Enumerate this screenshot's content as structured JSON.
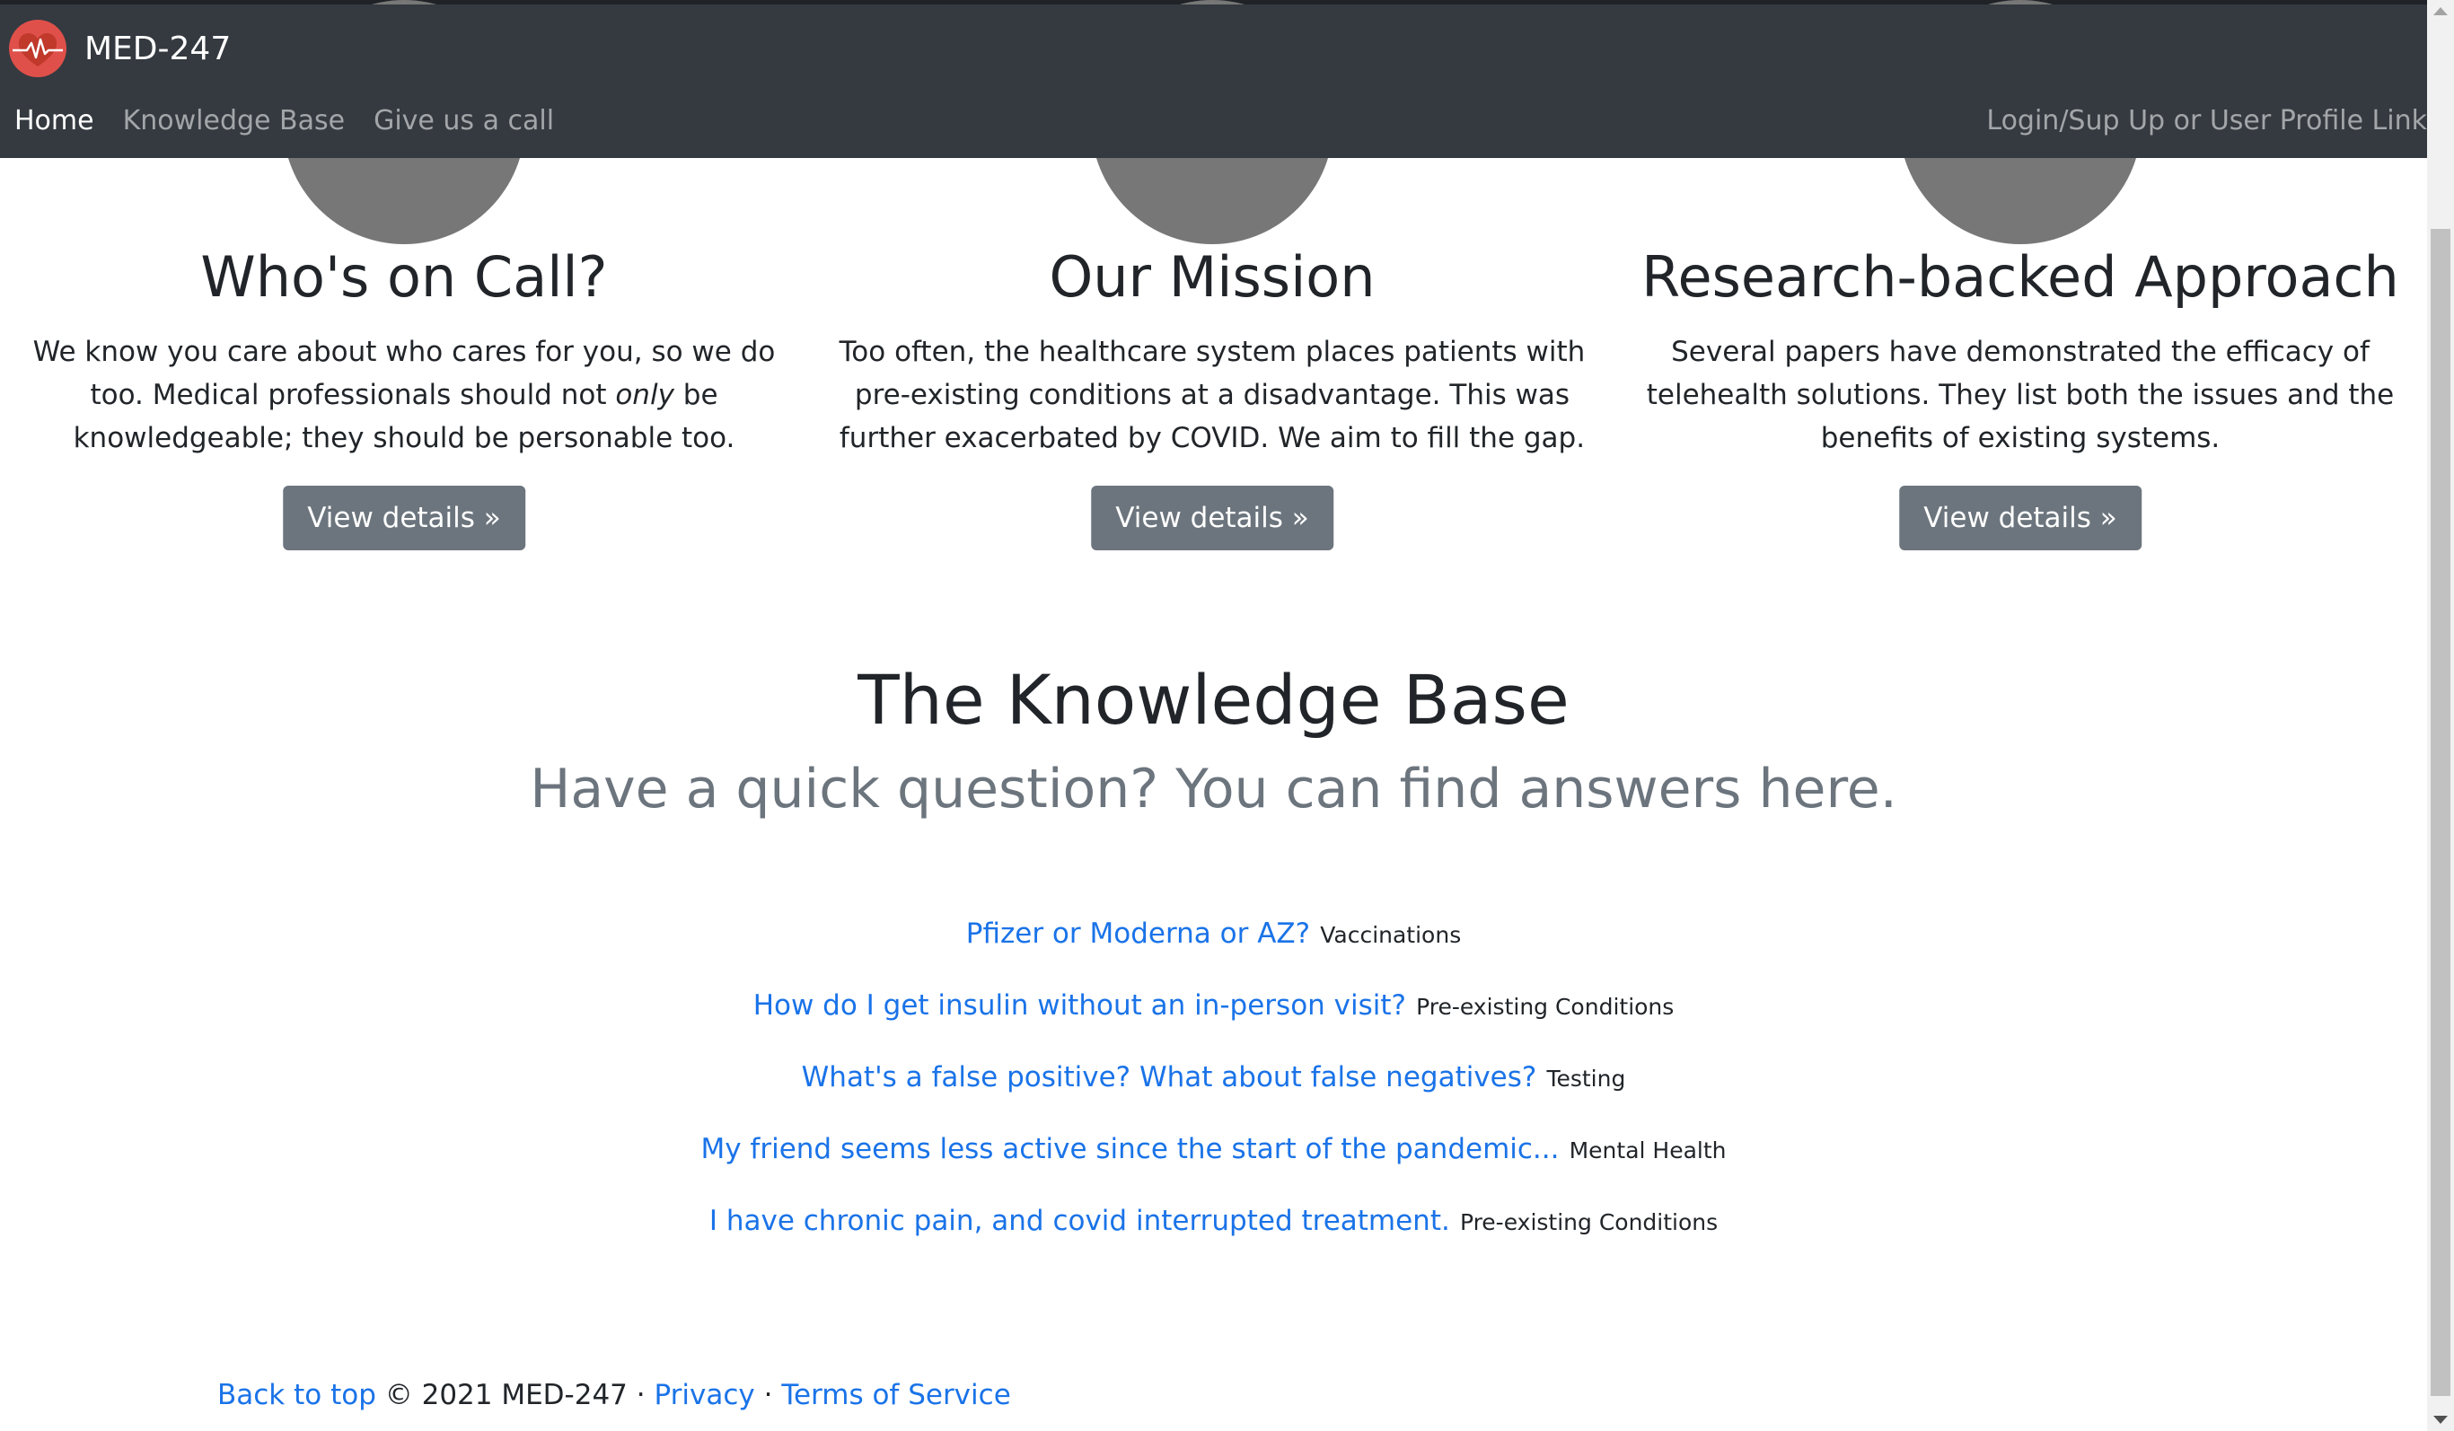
{
  "navbar": {
    "brand": "MED-247",
    "links": [
      {
        "label": "Home",
        "active": true
      },
      {
        "label": "Knowledge Base",
        "active": false
      },
      {
        "label": "Give us a call",
        "active": false
      }
    ],
    "right_link": "Login/Sup Up or User Profile Link"
  },
  "features": [
    {
      "title": "Who's on Call?",
      "text_before": "We know you care about who cares for you, so we do too. Medical professionals should not ",
      "text_em": "only",
      "text_after": " be knowledgeable; they should be personable too.",
      "button": "View details »"
    },
    {
      "title": "Our Mission",
      "text_before": "Too often, the healthcare system places patients with pre-existing conditions at a disadvantage. This was further exacerbated by COVID. We aim to fill the gap.",
      "text_em": "",
      "text_after": "",
      "button": "View details »"
    },
    {
      "title": "Research-backed Approach",
      "text_before": "Several papers have demonstrated the efficacy of telehealth solutions. They list both the issues and the benefits of existing systems.",
      "text_em": "",
      "text_after": "",
      "button": "View details »"
    }
  ],
  "knowledge_base": {
    "title": "The Knowledge Base",
    "subtitle": "Have a quick question? You can find answers here.",
    "items": [
      {
        "question": "Pfizer or Moderna or AZ?",
        "tag": "Vaccinations"
      },
      {
        "question": "How do I get insulin without an in-person visit?",
        "tag": "Pre-existing Conditions"
      },
      {
        "question": "What's a false positive? What about false negatives?",
        "tag": "Testing"
      },
      {
        "question": "My friend seems less active since the start of the pandemic...",
        "tag": "Mental Health"
      },
      {
        "question": "I have chronic pain, and covid interrupted treatment.",
        "tag": "Pre-existing Conditions"
      }
    ]
  },
  "footer": {
    "back_to_top": "Back to top",
    "copyright": "© 2021 MED-247 ·",
    "privacy": "Privacy",
    "separator": "·",
    "terms": "Terms of Service"
  },
  "colors": {
    "navbar_bg": "#343a40",
    "button_bg": "#6c757d",
    "link": "#1a73e8",
    "logo": "#e0504a"
  }
}
